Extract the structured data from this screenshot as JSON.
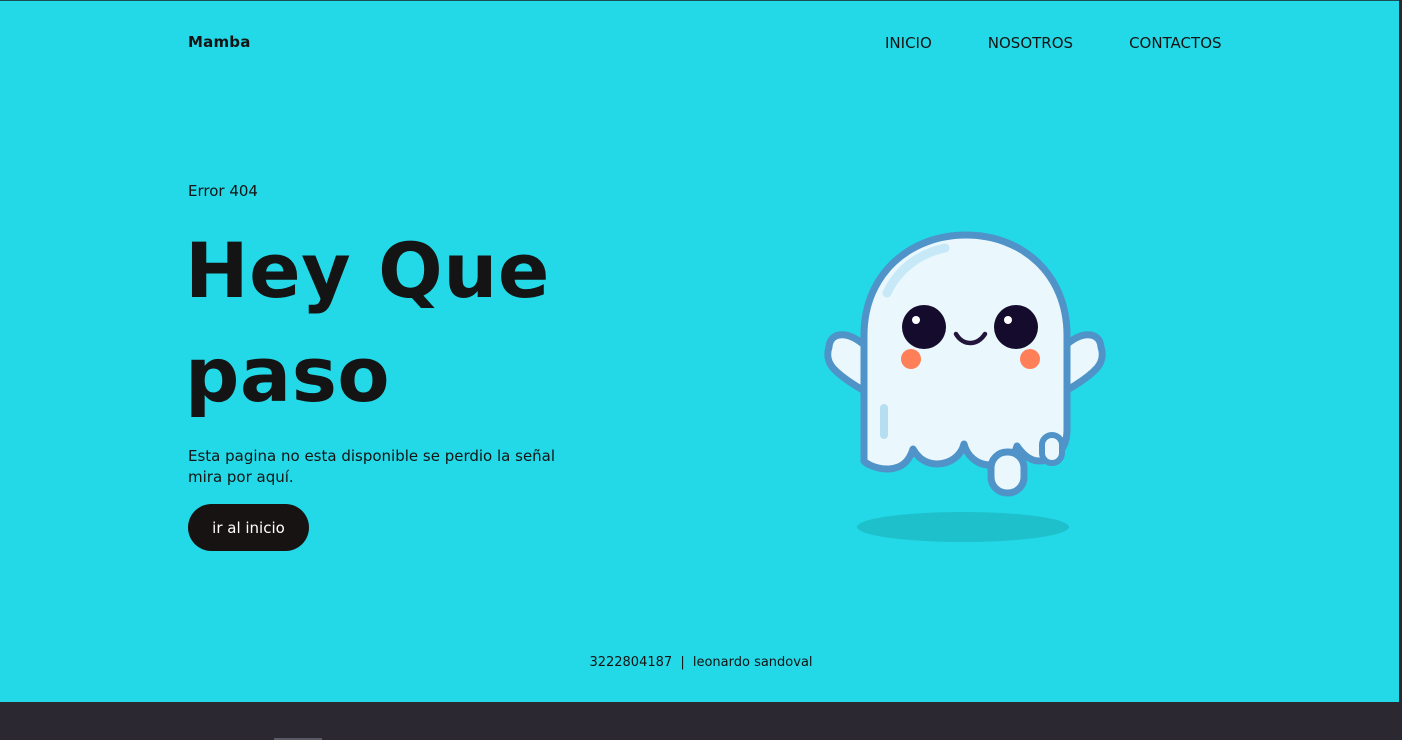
{
  "brand": {
    "name": "Mamba"
  },
  "nav": {
    "items": [
      {
        "label": "INICIO"
      },
      {
        "label": "NOSOTROS"
      },
      {
        "label": "CONTACTOS"
      }
    ]
  },
  "hero": {
    "eyebrow": "Error 404",
    "title_line1": "Hey Que",
    "title_line2": "paso",
    "description_line1": "Esta pagina no esta disponible se perdio la señal",
    "description_line2": "mira por aquí.",
    "button_label": "ir al inicio",
    "illustration_name": "ghost-illustration"
  },
  "footer": {
    "phone": "3222804187",
    "separator": "|",
    "author": "leonardo sandoval"
  },
  "colors": {
    "background": "#23d9e7",
    "button": "#171312",
    "text": "#141414",
    "bottom_bar": "#2b2832"
  }
}
